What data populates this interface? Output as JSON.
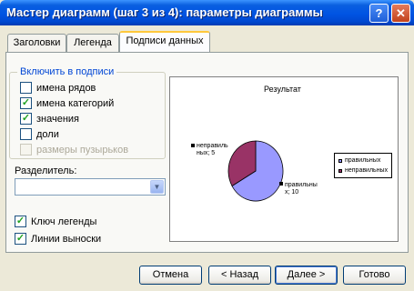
{
  "window": {
    "title": "Мастер диаграмм (шаг 3 из 4): параметры диаграммы",
    "help_label": "?",
    "close_label": "✕"
  },
  "tabs": [
    {
      "label": "Заголовки"
    },
    {
      "label": "Легенда"
    },
    {
      "label": "Подписи данных",
      "active": true
    }
  ],
  "include_group": {
    "legend": "Включить в подписи",
    "options": [
      {
        "label": "имена рядов",
        "checked": false,
        "enabled": true
      },
      {
        "label": "имена категорий",
        "checked": true,
        "enabled": true
      },
      {
        "label": "значения",
        "checked": true,
        "enabled": true
      },
      {
        "label": "доли",
        "checked": false,
        "enabled": true
      },
      {
        "label": "размеры пузырьков",
        "checked": false,
        "enabled": false
      }
    ]
  },
  "separator": {
    "label": "Разделитель:",
    "value": ""
  },
  "legend_key": {
    "label": "Ключ легенды",
    "checked": true
  },
  "leader_lines": {
    "label": "Линии выноски",
    "checked": true
  },
  "preview": {
    "title": "Результат",
    "colors": {
      "slice_a": "#993366",
      "slice_b": "#9999ff"
    },
    "data_labels": [
      {
        "text": "неправиль ных; 5"
      },
      {
        "text": "правильны х; 10"
      }
    ],
    "legend": [
      {
        "label": "правильных",
        "color": "#9999ff"
      },
      {
        "label": "неправильных",
        "color": "#993366"
      }
    ]
  },
  "chart_data": {
    "type": "pie",
    "title": "Результат",
    "categories": [
      "правильных",
      "неправильных"
    ],
    "values": [
      10,
      5
    ],
    "legend": "right"
  },
  "buttons": {
    "cancel": "Отмена",
    "back": "< Назад",
    "next": "Далее >",
    "finish": "Готово"
  },
  "check_mark": "✓",
  "dropdown_arrow": "▼"
}
